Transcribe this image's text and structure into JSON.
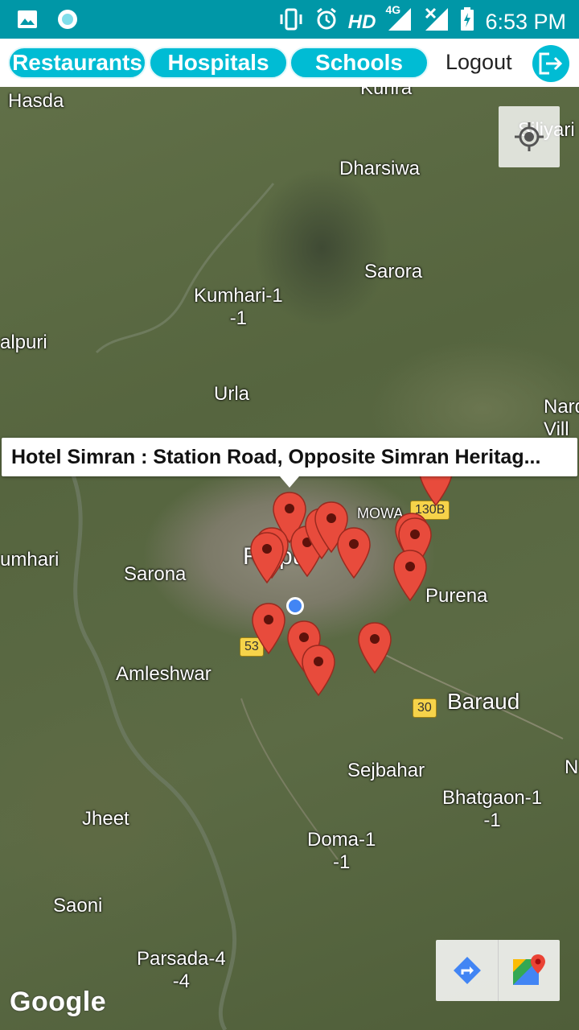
{
  "status_bar": {
    "time": "6:53 PM",
    "hd_label": "HD",
    "network": "4G",
    "icons": [
      "image-icon",
      "circle-app-icon",
      "vibrate-icon",
      "alarm-icon",
      "signal-icon",
      "no-signal-icon",
      "battery-charging-icon"
    ]
  },
  "toolbar": {
    "restaurants": "Restaurants",
    "hospitals": "Hospitals",
    "schools": "Schools",
    "logout": "Logout",
    "logout_icon": "logout-icon",
    "accent_color": "#00bcd4"
  },
  "map": {
    "places": [
      {
        "name": "Hasda"
      },
      {
        "name": "Kunra"
      },
      {
        "name": "Siliyari"
      },
      {
        "name": "Dharsiwa"
      },
      {
        "name": "Sarora"
      },
      {
        "name": "Kumhari-1\n-1"
      },
      {
        "name": "alpuri"
      },
      {
        "name": "Urla"
      },
      {
        "name": "Nard\nVill"
      },
      {
        "name": "MOWA"
      },
      {
        "name": "umhari"
      },
      {
        "name": "Sarona"
      },
      {
        "name": "Raipur"
      },
      {
        "name": "Purena"
      },
      {
        "name": "Amleshwar"
      },
      {
        "name": "Baraud"
      },
      {
        "name": "Sejbahar"
      },
      {
        "name": "Bhatgaon-1\n-1"
      },
      {
        "name": "Jheet"
      },
      {
        "name": "Doma-1\n-1"
      },
      {
        "name": "Saoni"
      },
      {
        "name": "Parsada-4\n-4"
      },
      {
        "name": "N"
      }
    ],
    "road_shields": [
      {
        "label": "130B"
      },
      {
        "label": "53"
      },
      {
        "label": "30"
      }
    ],
    "info_window": "Hotel Simran : Station Road, Opposite Simran Heritag...",
    "marker_color": "#e84b3c",
    "my_location_color": "#4285f4",
    "my_location_button": "my-location-icon",
    "directions_button": "directions-icon",
    "google_maps_button": "google-maps-icon",
    "attribution": "Google"
  }
}
